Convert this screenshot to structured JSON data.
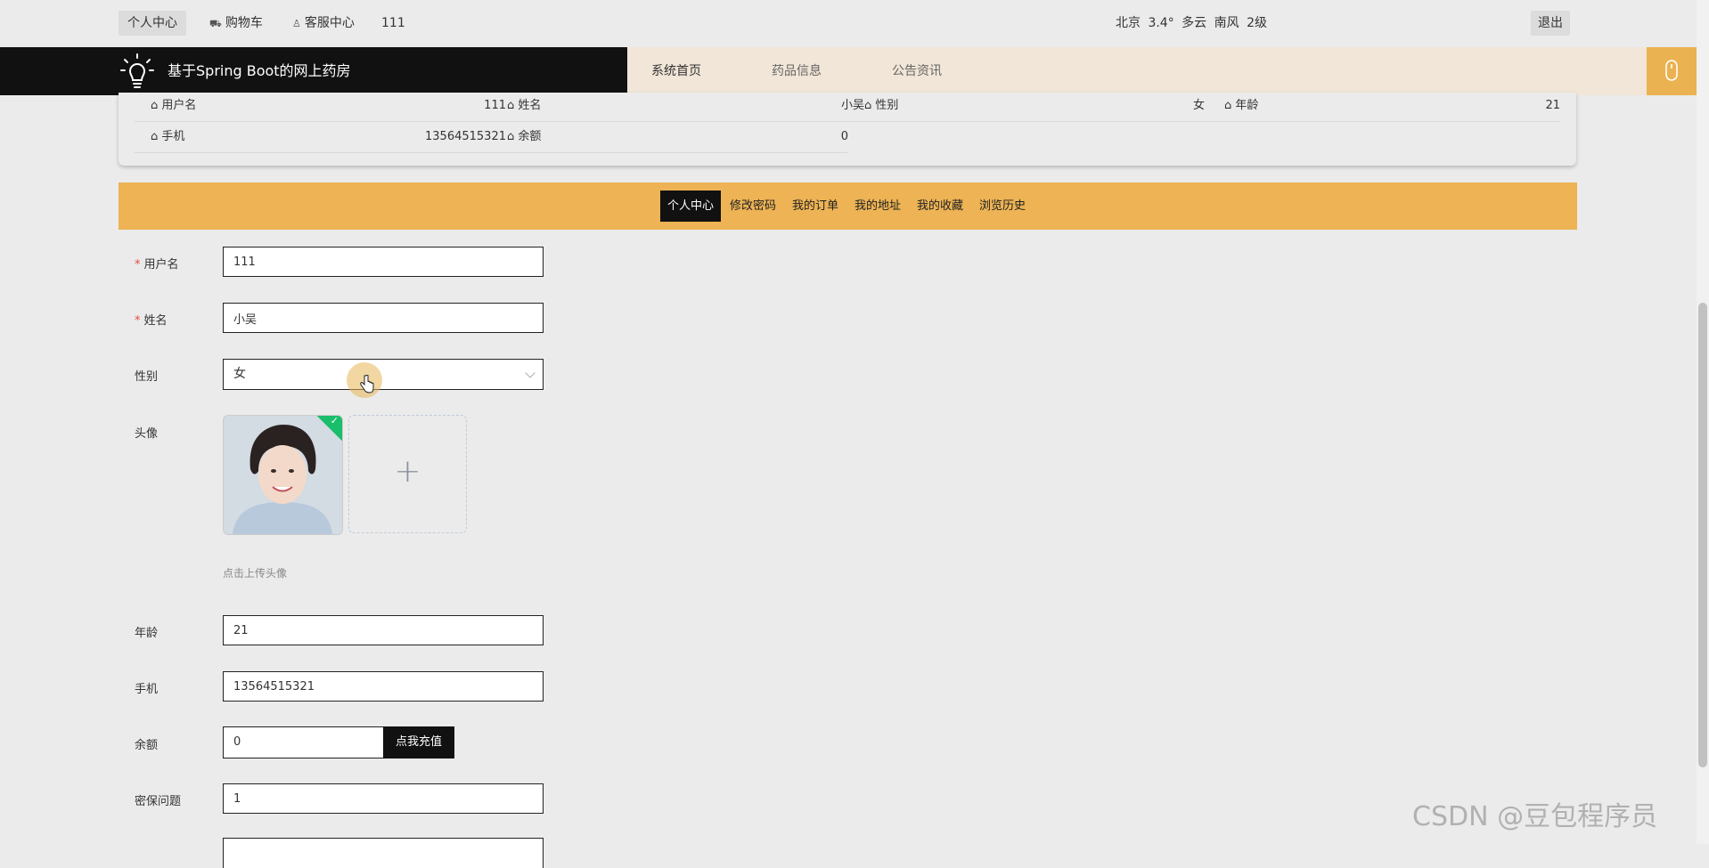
{
  "topbar": {
    "personal": "个人中心",
    "cart": "购物车",
    "service": "客服中心",
    "username": "111",
    "weather": "北京 3.4° 多云 南风 2级",
    "logout": "退出"
  },
  "navbar": {
    "site_title": "基于Spring Boot的网上药房",
    "menu": [
      "系统首页",
      "药品信息",
      "公告资讯"
    ]
  },
  "info": {
    "row1": [
      {
        "label": "用户名",
        "value": "111"
      },
      {
        "label": "姓名",
        "value": "小吴"
      },
      {
        "label": "性别",
        "value": "女"
      },
      {
        "label": "年龄",
        "value": "21"
      }
    ],
    "row2": [
      {
        "label": "手机",
        "value": "13564515321"
      },
      {
        "label": "余额",
        "value": "0"
      }
    ]
  },
  "tabs": [
    "个人中心",
    "修改密码",
    "我的订单",
    "我的地址",
    "我的收藏",
    "浏览历史"
  ],
  "form": {
    "username": {
      "label": "用户名",
      "value": "111"
    },
    "name": {
      "label": "姓名",
      "value": "小吴"
    },
    "gender": {
      "label": "性别",
      "value": "女"
    },
    "avatar": {
      "label": "头像",
      "hint": "点击上传头像"
    },
    "age": {
      "label": "年龄",
      "value": "21"
    },
    "phone": {
      "label": "手机",
      "value": "13564515321"
    },
    "balance": {
      "label": "余额",
      "value": "0",
      "button": "点我充值"
    },
    "question": {
      "label": "密保问题",
      "value": "1"
    }
  },
  "watermark": "CSDN @豆包程序员",
  "colors": {
    "accent": "#edb354",
    "dark": "#111111",
    "menu_bg": "#f1e6d7",
    "success": "#19be6b"
  }
}
